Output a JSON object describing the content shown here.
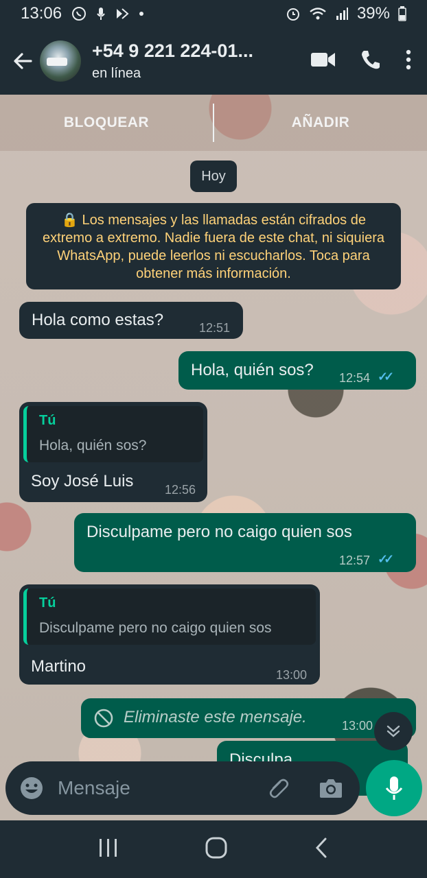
{
  "status_bar": {
    "time": "13:06",
    "battery": "39%",
    "icons": [
      "whatsapp-icon",
      "mic-icon",
      "vpn-icon",
      "dot-icon",
      "alarm-icon",
      "wifi-icon",
      "signal-icon",
      "battery-icon"
    ]
  },
  "header": {
    "title": "+54 9 221 224-01...",
    "subtitle": "en línea"
  },
  "actions": {
    "block": "BLOQUEAR",
    "add": "AÑADIR"
  },
  "date_chip": "Hoy",
  "encryption_notice": "🔒 Los mensajes y las llamadas están cifrados de extremo a extremo. Nadie fuera de este chat, ni siquiera WhatsApp, puede leerlos ni escucharlos. Toca para obtener más información.",
  "messages": [
    {
      "dir": "in",
      "text": "Hola como estas?",
      "time": "12:51"
    },
    {
      "dir": "out",
      "text": "Hola, quién sos?",
      "time": "12:54",
      "status": "read"
    },
    {
      "dir": "in",
      "quote_name": "Tú",
      "quote_text": "Hola, quién sos?",
      "text": "Soy José Luis",
      "time": "12:56"
    },
    {
      "dir": "out",
      "text": "Disculpame pero no caigo quien sos",
      "time": "12:57",
      "status": "read"
    },
    {
      "dir": "in",
      "quote_name": "Tú",
      "quote_text": "Disculpame pero no caigo quien sos",
      "text": "Martino",
      "time": "13:00"
    },
    {
      "dir": "out",
      "text": "Eliminaste este mensaje.",
      "time": "13:00",
      "deleted": true
    },
    {
      "dir": "out",
      "text": "Disculpa",
      "time": "",
      "partial": true
    }
  ],
  "composer": {
    "placeholder": "Mensaje"
  },
  "colors": {
    "accent": "#00a884",
    "outgoing": "#005c4b",
    "incoming": "#1f2c34",
    "quote_name": "#06cf9c",
    "read_ticks": "#53bdeb",
    "notice": "#ffd279"
  }
}
